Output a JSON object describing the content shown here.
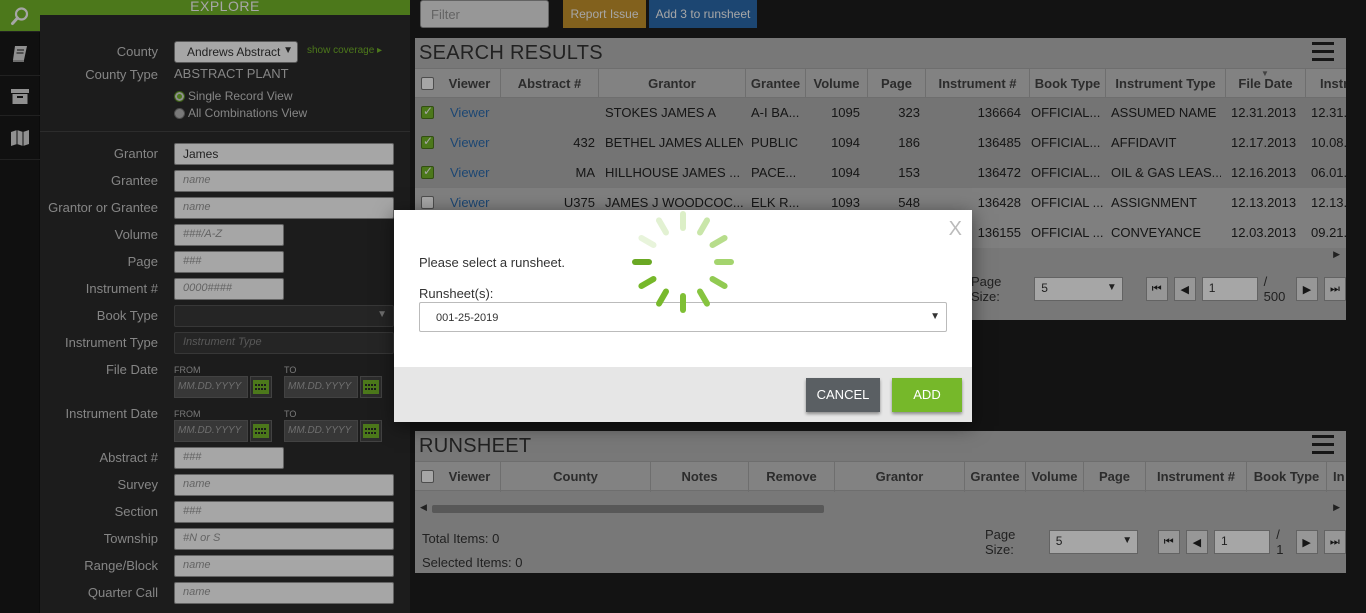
{
  "colors": {
    "accent": "#76b82a",
    "report": "#c8952d",
    "primary": "#2b6cb0"
  },
  "rail": {
    "items": [
      "search-icon",
      "book-icon",
      "archive-icon",
      "map-icon"
    ]
  },
  "explore": {
    "header": "EXPLORE",
    "county_label": "County",
    "county_value": "Andrews Abstract",
    "show_coverage": "show coverage ▸",
    "county_type_label": "County Type",
    "county_type_value": "ABSTRACT PLANT",
    "view_single": "Single Record View",
    "view_all": "All Combinations View",
    "fields": {
      "grantor": {
        "label": "Grantor",
        "value": "James"
      },
      "grantee": {
        "label": "Grantee",
        "placeholder": "name"
      },
      "grantor_or_grantee": {
        "label": "Grantor or Grantee",
        "placeholder": "name"
      },
      "volume": {
        "label": "Volume",
        "placeholder": "###/A-Z"
      },
      "page": {
        "label": "Page",
        "placeholder": "###"
      },
      "instrument_no": {
        "label": "Instrument #",
        "placeholder": "0000####"
      },
      "book_type": {
        "label": "Book Type",
        "value": ""
      },
      "instrument_type": {
        "label": "Instrument Type",
        "placeholder": "Instrument Type"
      },
      "file_date": {
        "label": "File Date",
        "from": "FROM",
        "to": "TO",
        "placeholder": "MM.DD.YYYY"
      },
      "instrument_date": {
        "label": "Instrument Date",
        "from": "FROM",
        "to": "TO",
        "placeholder": "MM.DD.YYYY"
      },
      "abstract_no": {
        "label": "Abstract #",
        "placeholder": "###"
      },
      "survey": {
        "label": "Survey",
        "placeholder": "name"
      },
      "section": {
        "label": "Section",
        "placeholder": "###"
      },
      "township": {
        "label": "Township",
        "placeholder": "#N or S"
      },
      "range_block": {
        "label": "Range/Block",
        "placeholder": "name"
      },
      "quarter_call": {
        "label": "Quarter Call",
        "placeholder": "name"
      }
    }
  },
  "toolbar": {
    "filter_placeholder": "Filter",
    "report_issue": "Report Issue",
    "add_to_runsheet": "Add 3 to runsheet"
  },
  "search_results": {
    "title": "SEARCH RESULTS",
    "columns": [
      "Viewer",
      "Abstract #",
      "Grantor",
      "Grantee",
      "Volume",
      "Page",
      "Instrument #",
      "Book Type",
      "Instrument Type",
      "File Date",
      "Instr"
    ],
    "rows": [
      {
        "checked": true,
        "viewer": "Viewer",
        "abstract": "",
        "grantor": "STOKES JAMES A",
        "grantee": "A-I BA...",
        "volume": "1095",
        "page": "323",
        "instrument": "136664",
        "book_type": "OFFICIAL...",
        "instrument_type": "ASSUMED NAME",
        "file_date": "12.31.2013",
        "instr_date": "12.31."
      },
      {
        "checked": true,
        "viewer": "Viewer",
        "abstract": "432",
        "grantor": "BETHEL JAMES ALLEN",
        "grantee": "PUBLIC",
        "volume": "1094",
        "page": "186",
        "instrument": "136485",
        "book_type": "OFFICIAL...",
        "instrument_type": "AFFIDAVIT",
        "file_date": "12.17.2013",
        "instr_date": "10.08."
      },
      {
        "checked": true,
        "viewer": "Viewer",
        "abstract": "MA",
        "grantor": "HILLHOUSE JAMES ...",
        "grantee": "PACE...",
        "volume": "1094",
        "page": "153",
        "instrument": "136472",
        "book_type": "OFFICIAL...",
        "instrument_type": "OIL & GAS LEAS...",
        "file_date": "12.16.2013",
        "instr_date": "06.01."
      },
      {
        "checked": false,
        "viewer": "Viewer",
        "abstract": "U375",
        "grantor": "JAMES J WOODCOC...",
        "grantee": "ELK R...",
        "volume": "1093",
        "page": "548",
        "instrument": "136428",
        "book_type": "OFFICIAL ...",
        "instrument_type": "ASSIGNMENT",
        "file_date": "12.13.2013",
        "instr_date": "12.13."
      },
      {
        "checked": false,
        "viewer": "Viewer",
        "abstract": "",
        "grantor": "",
        "grantee": "",
        "volume": "",
        "page": "",
        "instrument": "136155",
        "book_type": "OFFICIAL ...",
        "instrument_type": "CONVEYANCE",
        "file_date": "12.03.2013",
        "instr_date": "09.21."
      }
    ],
    "page_size_label": "Page Size:",
    "page_size": "5",
    "page": "1",
    "total_pages": "/ 500"
  },
  "runsheet": {
    "title": "RUNSHEET",
    "columns": [
      "Viewer",
      "County",
      "Notes",
      "Remove",
      "Grantor",
      "Grantee",
      "Volume",
      "Page",
      "Instrument #",
      "Book Type",
      "In"
    ],
    "total_items": "Total Items: 0",
    "selected_items": "Selected Items: 0",
    "page_size_label": "Page Size:",
    "page_size": "5",
    "page": "1",
    "total_pages": "/ 1"
  },
  "modal": {
    "close": "X",
    "message": "Please select a runsheet.",
    "runsheet_label": "Runsheet(s):",
    "runsheet_value": "001-25-2019",
    "cancel": "CANCEL",
    "add": "ADD"
  }
}
